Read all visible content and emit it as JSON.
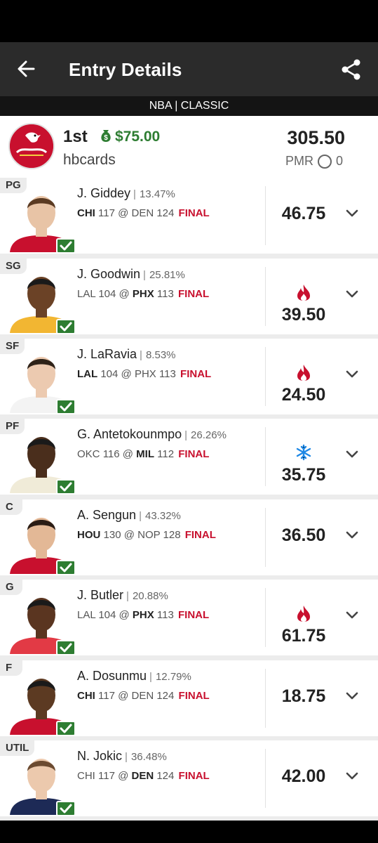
{
  "header": {
    "title": "Entry Details",
    "back_icon": "arrow-left-icon",
    "share_icon": "share-icon"
  },
  "contest": {
    "label": "NBA | CLASSIC"
  },
  "entry": {
    "rank": "1st",
    "prize": "$75.00",
    "username": "hbcards",
    "total_points": "305.50",
    "pmr_label": "PMR",
    "pmr_value": "0",
    "logo_icon": "cardinals-logo-icon"
  },
  "colors": {
    "final": "#c8102e",
    "prize": "#2e7d32",
    "hot": "#c8102e",
    "cold": "#1e88e5",
    "check": "#2e7d32"
  },
  "players": [
    {
      "pos": "PG",
      "name": "J. Giddey",
      "own": "13.47%",
      "away": "CHI",
      "away_score": "117",
      "home": "DEN",
      "home_score": "124",
      "team": "away",
      "status": "FINAL",
      "points": "46.75",
      "trend": "",
      "jersey": "#c8102e",
      "skin": "#e8c4a6",
      "hair": "#5a3a22"
    },
    {
      "pos": "SG",
      "name": "J. Goodwin",
      "own": "25.81%",
      "away": "LAL",
      "away_score": "104",
      "home": "PHX",
      "home_score": "113",
      "team": "home",
      "status": "FINAL",
      "points": "39.50",
      "trend": "hot",
      "jersey": "#f2b632",
      "skin": "#6b4226",
      "hair": "#1a1a1a"
    },
    {
      "pos": "SF",
      "name": "J. LaRavia",
      "own": "8.53%",
      "away": "LAL",
      "away_score": "104",
      "home": "PHX",
      "home_score": "113",
      "team": "away",
      "status": "FINAL",
      "points": "24.50",
      "trend": "hot",
      "jersey": "#f3f3f3",
      "skin": "#eccab0",
      "hair": "#2e2218"
    },
    {
      "pos": "PF",
      "name": "G. Antetokounmpo",
      "own": "26.26%",
      "away": "OKC",
      "away_score": "116",
      "home": "MIL",
      "home_score": "112",
      "team": "home",
      "status": "FINAL",
      "points": "35.75",
      "trend": "cold",
      "jersey": "#f0ebd8",
      "skin": "#4a2e1c",
      "hair": "#1a1a1a"
    },
    {
      "pos": "C",
      "name": "A. Sengun",
      "own": "43.32%",
      "away": "HOU",
      "away_score": "130",
      "home": "NOP",
      "home_score": "128",
      "team": "away",
      "status": "FINAL",
      "points": "36.50",
      "trend": "",
      "jersey": "#c8102e",
      "skin": "#e3b896",
      "hair": "#2a1c14"
    },
    {
      "pos": "G",
      "name": "J. Butler",
      "own": "20.88%",
      "away": "LAL",
      "away_score": "104",
      "home": "PHX",
      "home_score": "113",
      "team": "home",
      "status": "FINAL",
      "points": "61.75",
      "trend": "hot",
      "jersey": "#e23a45",
      "skin": "#5a3520",
      "hair": "#1a1a1a"
    },
    {
      "pos": "F",
      "name": "A. Dosunmu",
      "own": "12.79%",
      "away": "CHI",
      "away_score": "117",
      "home": "DEN",
      "home_score": "124",
      "team": "away",
      "status": "FINAL",
      "points": "18.75",
      "trend": "",
      "jersey": "#c8102e",
      "skin": "#5c3a22",
      "hair": "#1a1a1a"
    },
    {
      "pos": "UTIL",
      "name": "N. Jokic",
      "own": "36.48%",
      "away": "CHI",
      "away_score": "117",
      "home": "DEN",
      "home_score": "124",
      "team": "home",
      "status": "FINAL",
      "points": "42.00",
      "trend": "",
      "jersey": "#1d2a56",
      "skin": "#ecc9ad",
      "hair": "#6b4a30"
    }
  ]
}
